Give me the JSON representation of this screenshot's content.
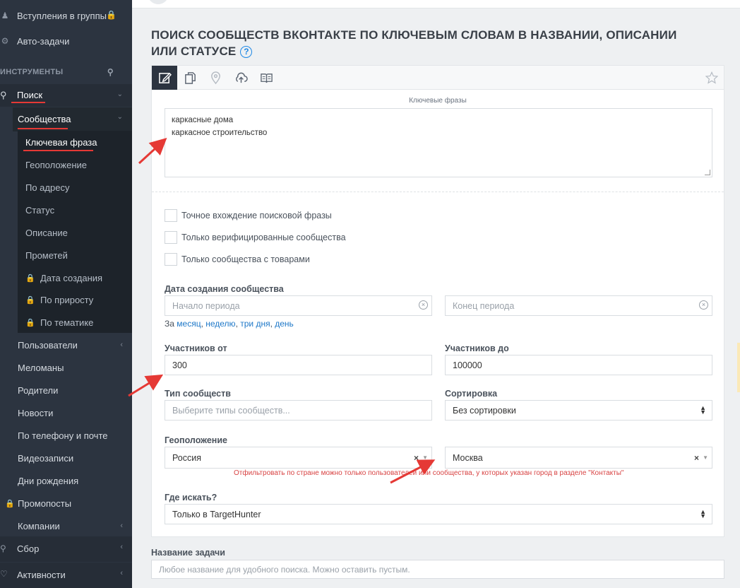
{
  "sidebar": {
    "top_items": [
      {
        "label": "Вступления в группы",
        "icon": "user-plus-icon"
      },
      {
        "label": "Авто-задачи",
        "icon": "gears-icon"
      }
    ],
    "section_header": "ИНСТРУМЕНТЫ",
    "search": {
      "label": "Поиск",
      "icon": "search-icon"
    },
    "communities": {
      "label": "Сообщества"
    },
    "sub_items": [
      {
        "label": "Ключевая фраза"
      },
      {
        "label": "Геоположение"
      },
      {
        "label": "По адресу"
      },
      {
        "label": "Статус"
      },
      {
        "label": "Описание"
      },
      {
        "label": "Прометей"
      },
      {
        "label": "Дата создания"
      },
      {
        "label": "По приросту"
      },
      {
        "label": "По тематике"
      }
    ],
    "search_items": [
      {
        "label": "Пользователи"
      },
      {
        "label": "Меломаны"
      },
      {
        "label": "Родители"
      },
      {
        "label": "Новости"
      },
      {
        "label": "По телефону и почте"
      },
      {
        "label": "Видеозаписи"
      },
      {
        "label": "Дни рождения"
      },
      {
        "label": "Промопосты"
      },
      {
        "label": "Компании"
      }
    ],
    "bottom_items": [
      {
        "label": "Сбор",
        "icon": "collect-icon"
      },
      {
        "label": "Активности",
        "icon": "heart-icon"
      }
    ]
  },
  "page": {
    "title": "ПОИСК СООБЩЕСТВ ВКОНТАКТЕ ПО КЛЮЧЕВЫМ СЛОВАМ В НАЗВАНИИ, ОПИСАНИИ ИЛИ СТАТУСЕ",
    "help_glyph": "?"
  },
  "form": {
    "keywords_caption": "Ключевые фразы",
    "keywords_lines": [
      "каркасные дома",
      "каркасное строительство"
    ],
    "checkboxes": [
      {
        "label": "Точное вхождение поисковой фразы",
        "checked": false
      },
      {
        "label": "Только верифицированные сообщества",
        "checked": false
      },
      {
        "label": "Только сообщества с товарами",
        "checked": false
      }
    ],
    "date_label": "Дата создания сообщества",
    "date_start_placeholder": "Начало периода",
    "date_end_placeholder": "Конец периода",
    "quick_prefix": "За",
    "quick_links": [
      "месяц",
      "неделю",
      "три дня",
      "день"
    ],
    "members_from_label": "Участников от",
    "members_from_value": "300",
    "members_to_label": "Участников до",
    "members_to_value": "100000",
    "type_label": "Тип сообществ",
    "type_placeholder": "Выберите типы сообществ...",
    "sort_label": "Сортировка",
    "sort_value": "Без сортировки",
    "geo_label": "Геоположение",
    "country_value": "Россия",
    "city_value": "Москва",
    "geo_error": "Отфильтровать по стране можно только пользователей или сообщества, у которых указан город в разделе \"Контакты\"",
    "where_label": "Где искать?",
    "where_value": "Только в TargetHunter",
    "task_label": "Название задачи",
    "task_placeholder": "Любое название для удобного поиска. Можно оставить пустым."
  },
  "colors": {
    "sidebar_bg": "#2c3440",
    "accent_red": "#e53935",
    "link_blue": "#1e78c8",
    "error_red": "#d84343"
  }
}
